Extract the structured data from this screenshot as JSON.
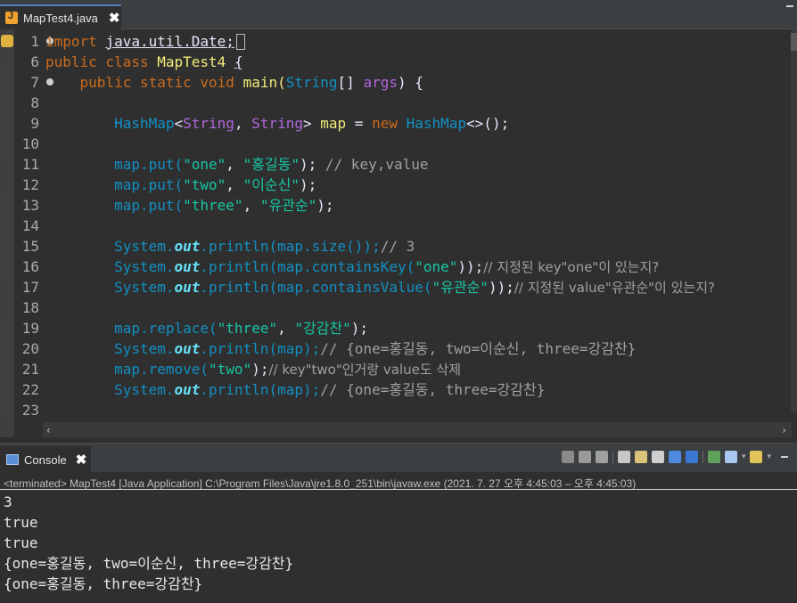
{
  "editor": {
    "tab_title": "MapTest4.java",
    "tab_close": "✖",
    "line_numbers": [
      "1",
      "6",
      "7",
      "8",
      "9",
      "10",
      "11",
      "12",
      "13",
      "14",
      "15",
      "16",
      "17",
      "18",
      "19",
      "20",
      "21",
      "22",
      "23"
    ],
    "code": {
      "l1_kw": "import",
      "l1_pkg": "java.util.Date;",
      "l6_kw": "public class",
      "l6_name": "MapTest4",
      "l6_brace": "{",
      "l7_kw": "public static void",
      "l7_main": "main(",
      "l7_type": "String",
      "l7_arr": "[] ",
      "l7_args": "args",
      "l7_end": ") {",
      "l9_type1": "HashMap",
      "l9_lt": "<",
      "l9_s1": "String",
      "l9_comma": ", ",
      "l9_s2": "String",
      "l9_gt": "> ",
      "l9_var": "map",
      "l9_eq": " = ",
      "l9_new": "new",
      "l9_type2": " HashMap",
      "l9_end": "<>();",
      "l11_a": "map.put(",
      "l11_s1": "\"one\"",
      "l11_c": ", ",
      "l11_s2": "\"홍길동\"",
      "l11_end": "); ",
      "l11_cm": "// key,value",
      "l12_a": "map.put(",
      "l12_s1": "\"two\"",
      "l12_c": ", ",
      "l12_s2": "\"이순신\"",
      "l12_end": ");",
      "l13_a": "map.put(",
      "l13_s1": "\"three\"",
      "l13_c": ", ",
      "l13_s2": "\"유관순\"",
      "l13_end": ");",
      "l15_sys": "System.",
      "l15_out": "out",
      "l15_rest": ".println(map.size());",
      "l15_cm": "// 3",
      "l16_sys": "System.",
      "l16_out": "out",
      "l16_rest": ".println(map.containsKey(",
      "l16_s": "\"one\"",
      "l16_end": "));",
      "l16_cm": "// 지정된 key\"one\"이 있는지?",
      "l17_sys": "System.",
      "l17_out": "out",
      "l17_rest": ".println(map.containsValue(",
      "l17_s": "\"유관순\"",
      "l17_end": "));",
      "l17_cm": "// 지정된 value\"유관순\"이 있는지?",
      "l19_a": "map.replace(",
      "l19_s1": "\"three\"",
      "l19_c": ", ",
      "l19_s2": "\"강감찬\"",
      "l19_end": ");",
      "l20_sys": "System.",
      "l20_out": "out",
      "l20_rest": ".println(map);",
      "l20_cm": "// {one=홍길동, two=이순신, three=강감찬}",
      "l21_a": "map.remove(",
      "l21_s": "\"two\"",
      "l21_end": ");",
      "l21_cm": "// key\"two\"인거랑 value도 삭제",
      "l22_sys": "System.",
      "l22_out": "out",
      "l22_rest": ".println(map);",
      "l22_cm": "// {one=홍길동, three=강감찬}"
    }
  },
  "console": {
    "tab_title": "Console",
    "tab_close": "✖",
    "status": "<terminated> MapTest4 [Java Application] C:\\Program Files\\Java\\jre1.8.0_251\\bin\\javaw.exe  (2021. 7. 27 오후 4:45:03 – 오후 4:45:03)",
    "output": [
      "3",
      "true",
      "true",
      "{one=홍길동, two=이순신, three=강감찬}",
      "{one=홍길동, three=강감찬}"
    ]
  },
  "colors": {
    "editor_bg": "#2f2f2f",
    "keyword": "#cc6c1d",
    "string": "#17c6a3",
    "type": "#1290c3",
    "comment": "#a0a0a0"
  }
}
